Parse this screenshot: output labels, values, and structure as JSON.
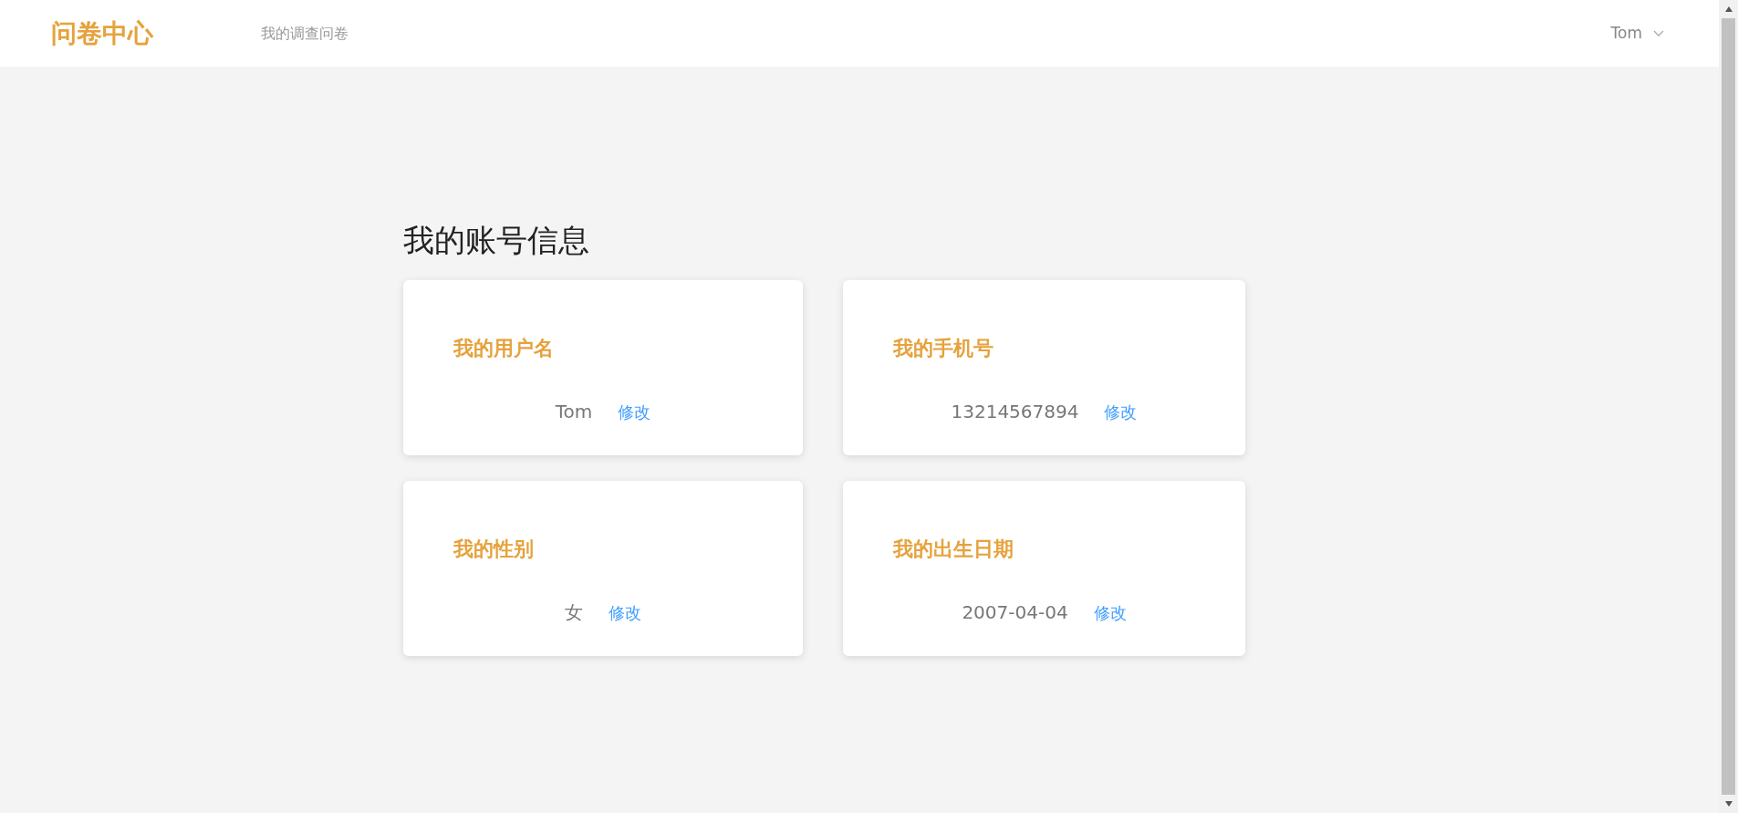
{
  "header": {
    "logo": "问卷中心",
    "nav": [
      {
        "label": "我的调查问卷",
        "selected": false
      }
    ],
    "user": "Tom"
  },
  "page_title": "我的账号信息",
  "cards": [
    {
      "title": "我的用户名",
      "value": "Tom",
      "action": "修改"
    },
    {
      "title": "我的手机号",
      "value": "13214567894",
      "action": "修改"
    },
    {
      "title": "我的性别",
      "value": "女",
      "action": "修改"
    },
    {
      "title": "我的出生日期",
      "value": "2007-04-04",
      "action": "修改"
    }
  ]
}
